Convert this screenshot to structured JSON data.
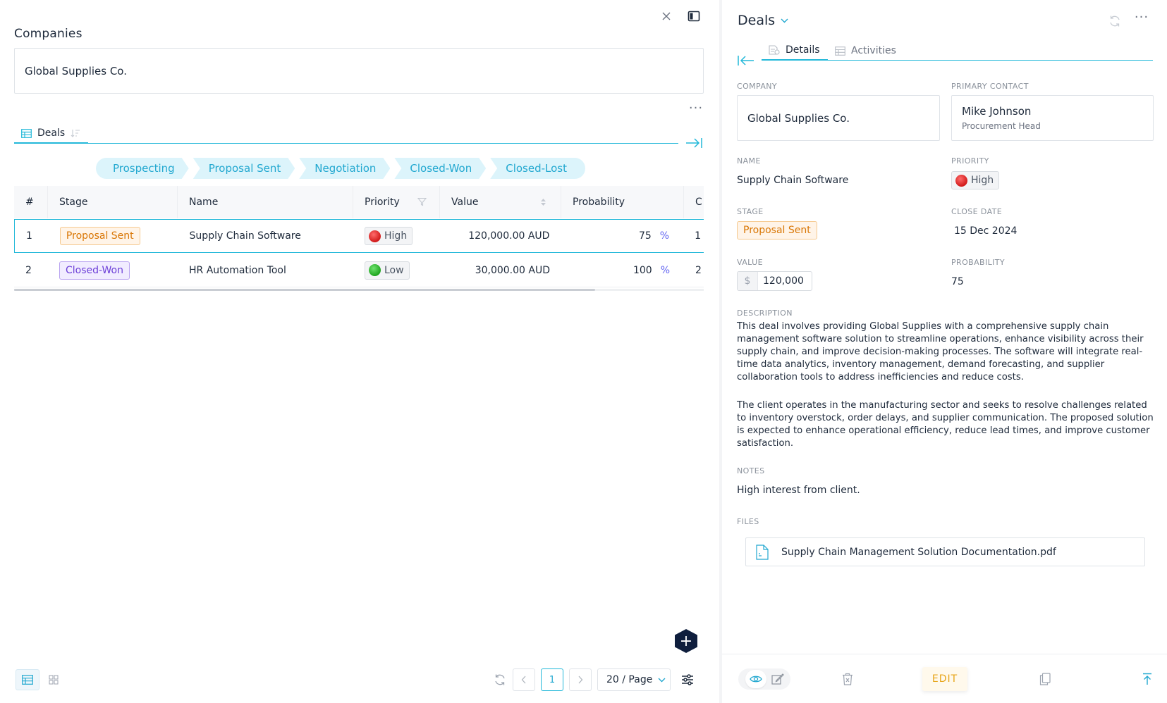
{
  "left": {
    "section_title": "Companies",
    "company_name": "Global Supplies Co.",
    "tab": {
      "label": "Deals"
    },
    "stages": [
      "Prospecting",
      "Proposal Sent",
      "Negotiation",
      "Closed-Won",
      "Closed-Lost"
    ],
    "table": {
      "columns": [
        "#",
        "Stage",
        "Name",
        "Priority",
        "Value",
        "Probability",
        "C"
      ],
      "rows": [
        {
          "index": "1",
          "stage": "Proposal Sent",
          "name": "Supply Chain Software",
          "priority": "High",
          "value": "120,000.00 AUD",
          "probability": "75",
          "pct": "%",
          "extra": "1"
        },
        {
          "index": "2",
          "stage": "Closed-Won",
          "name": "HR Automation Tool",
          "priority": "Low",
          "value": "30,000.00 AUD",
          "probability": "100",
          "pct": "%",
          "extra": "2"
        }
      ]
    },
    "pagination": {
      "current_page": "1",
      "per_page": "20 / Page"
    },
    "fab_label": "+"
  },
  "right": {
    "title": "Deals",
    "tabs": [
      "Details",
      "Activities"
    ],
    "fields": {
      "company_label": "COMPANY",
      "company_value": "Global Supplies Co.",
      "contact_label": "PRIMARY CONTACT",
      "contact_name": "Mike Johnson",
      "contact_role": "Procurement Head",
      "name_label": "NAME",
      "name_value": "Supply Chain Software",
      "priority_label": "PRIORITY",
      "priority_value": "High",
      "stage_label": "STAGE",
      "stage_value": "Proposal Sent",
      "close_date_label": "CLOSE DATE",
      "close_date_value": "15 Dec 2024",
      "value_label": "VALUE",
      "value_currency": "$",
      "value_amount": "120,000",
      "probability_label": "PROBABILITY",
      "probability_value": "75",
      "description_label": "DESCRIPTION",
      "description_p1": "This deal involves providing Global Supplies with a comprehensive supply chain management software solution to streamline operations, enhance visibility across their supply chain, and improve decision-making processes. The software will integrate real-time data analytics, inventory management, demand forecasting, and supplier collaboration tools to address inefficiencies and reduce costs.",
      "description_p2": "The client operates in the manufacturing sector and seeks to resolve challenges related to inventory overstock, order delays, and supplier communication. The proposed solution is expected to enhance operational efficiency, reduce lead times, and improve customer satisfaction.",
      "notes_label": "NOTES",
      "notes_value": "High interest from client.",
      "files_label": "FILES",
      "file_name": "Supply Chain Management Solution Documentation.pdf"
    },
    "bottom": {
      "edit_label": "EDIT"
    }
  },
  "colors": {
    "accent": "#22b8d9",
    "stage_bg": "#dcf4fb",
    "proposal_sent": "#d97706",
    "closed_won": "#6d3fd8",
    "edit": "#e7a51a",
    "fab": "#0f1e3d"
  },
  "icons": {
    "close": "close-icon",
    "sidebar": "sidebar-toggle-icon",
    "more": "more-icon",
    "table": "table-icon",
    "filter": "filter-icon",
    "sort": "sort-icon",
    "collapse": "collapse-icon",
    "refresh": "refresh-icon",
    "settings": "settings-icon",
    "pdf": "pdf-file-icon",
    "eye": "eye-icon",
    "edit": "edit-icon",
    "delete": "trash-icon",
    "copy": "copy-icon",
    "scroll_top": "scroll-top-icon"
  }
}
